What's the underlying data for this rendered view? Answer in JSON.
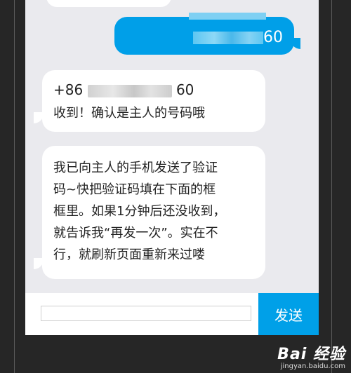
{
  "messages": [
    {
      "side": "sent",
      "text_visible": "60"
    },
    {
      "side": "received",
      "phone_prefix": "+86",
      "phone_suffix": "60",
      "text": "收到！确认是主人的号码哦"
    },
    {
      "side": "received",
      "lines": [
        "我已向主人的手机发送了验证",
        "码~快把验证码填在下面的框",
        "框里。如果1分钟后还没收到，",
        "就告诉我“再发一次”。实在不",
        "行，就刷新页面重新来过喽"
      ]
    }
  ],
  "input": {
    "value": "",
    "placeholder": ""
  },
  "send_button": {
    "label": "发送"
  },
  "watermark": {
    "logo_text": "Bai  经验",
    "url": "jingyan.baidu.com"
  },
  "colors": {
    "accent": "#009fe8",
    "background": "#eaeaee",
    "frame": "#262626"
  }
}
